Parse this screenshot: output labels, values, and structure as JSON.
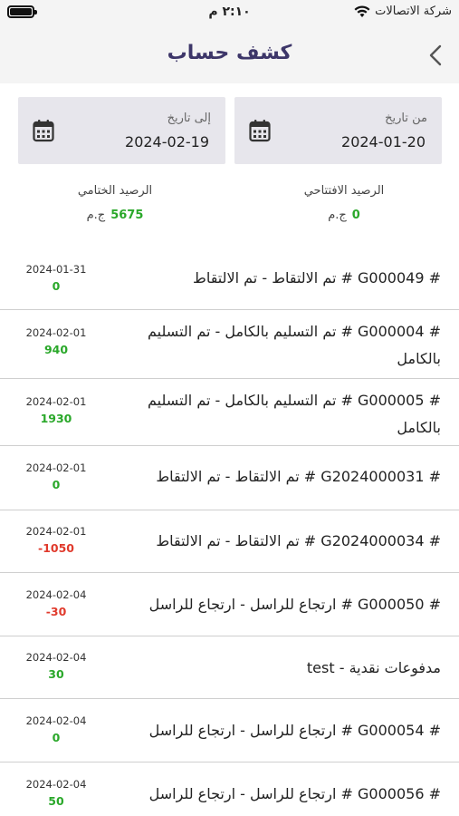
{
  "status_bar": {
    "carrier": "شركة الاتصالات",
    "time": "٢:١٠ م"
  },
  "nav": {
    "title": "كشف حساب",
    "back_icon": "chevron-left-icon"
  },
  "filters": {
    "from_label": "من تاريخ",
    "from_value": "2024-01-20",
    "to_label": "إلى تاريخ",
    "to_value": "2024-02-19",
    "icon": "calendar-icon"
  },
  "balances": {
    "opening_label": "الرصيد الافتتاحي",
    "opening_value": "0",
    "closing_label": "الرصيد الختامي",
    "closing_value": "5675",
    "currency": "ج.م"
  },
  "colors": {
    "accent": "#3d3669",
    "positive": "#2aa82a",
    "negative": "#e03a2c",
    "field_bg": "#e7e6ec"
  },
  "transactions": [
    {
      "desc": "# G000049 # تم الالتقاط - تم الالتقاط",
      "date": "2024-01-31",
      "amount": "0",
      "sign": "pos"
    },
    {
      "desc": "# G000004 # تم التسليم بالكامل - تم التسليم بالكامل",
      "date": "2024-02-01",
      "amount": "940",
      "sign": "pos"
    },
    {
      "desc": "# G000005 # تم التسليم بالكامل - تم التسليم بالكامل",
      "date": "2024-02-01",
      "amount": "1930",
      "sign": "pos"
    },
    {
      "desc": "# G2024000031 # تم الالتقاط - تم الالتقاط",
      "date": "2024-02-01",
      "amount": "0",
      "sign": "pos"
    },
    {
      "desc": "# G2024000034 # تم الالتقاط - تم الالتقاط",
      "date": "2024-02-01",
      "amount": "-1050",
      "sign": "neg"
    },
    {
      "desc": "# G000050 # ارتجاع للراسل - ارتجاع للراسل",
      "date": "2024-02-04",
      "amount": "-30",
      "sign": "neg"
    },
    {
      "desc": "مدفوعات نقدية - test",
      "date": "2024-02-04",
      "amount": "30",
      "sign": "pos"
    },
    {
      "desc": "# G000054 # ارتجاع للراسل - ارتجاع للراسل",
      "date": "2024-02-04",
      "amount": "0",
      "sign": "pos"
    },
    {
      "desc": "# G000056 # ارتجاع للراسل - ارتجاع للراسل",
      "date": "2024-02-04",
      "amount": "50",
      "sign": "pos"
    }
  ]
}
